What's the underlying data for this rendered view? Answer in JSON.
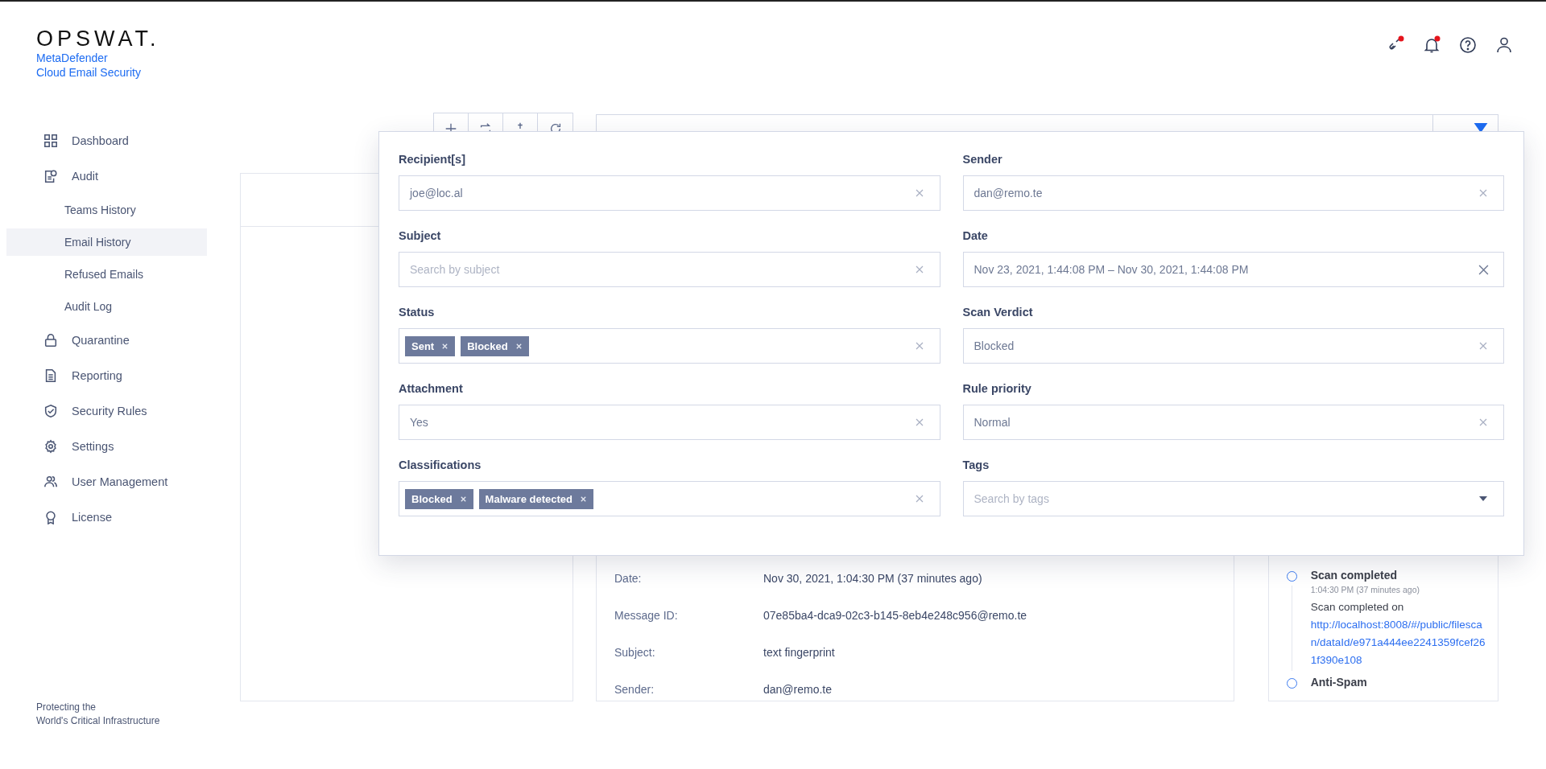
{
  "brand": {
    "logo": "OPSWAT.",
    "product_line1": "MetaDefender",
    "product_line2": "Cloud Email Security"
  },
  "header_icons": [
    {
      "alert": true
    },
    {
      "alert": true
    },
    {
      "alert": false
    },
    {
      "alert": false
    }
  ],
  "sidebar": {
    "items": [
      {
        "label": "Dashboard",
        "selected": false
      },
      {
        "label": "Audit",
        "selected": false,
        "children": [
          {
            "label": "Teams History",
            "selected": false
          },
          {
            "label": "Email History",
            "selected": true
          },
          {
            "label": "Refused Emails",
            "selected": false
          },
          {
            "label": "Audit Log",
            "selected": false
          }
        ]
      },
      {
        "label": "Quarantine",
        "selected": false
      },
      {
        "label": "Reporting",
        "selected": false
      },
      {
        "label": "Security Rules",
        "selected": false
      },
      {
        "label": "Settings",
        "selected": false
      },
      {
        "label": "User Management",
        "selected": false
      },
      {
        "label": "License",
        "selected": false
      }
    ],
    "footer_line1": "Protecting the",
    "footer_line2": "World's Critical Infrastructure"
  },
  "filter_panel": {
    "fields": [
      {
        "label": "Recipient[s]",
        "kind": "text",
        "value": "joe@loc.al"
      },
      {
        "label": "Sender",
        "kind": "text",
        "value": "dan@remo.te"
      },
      {
        "label": "Subject",
        "kind": "text",
        "placeholder": "Search by subject"
      },
      {
        "label": "Date",
        "kind": "date",
        "value": "Nov 23, 2021, 1:44:08 PM – Nov 30, 2021, 1:44:08 PM"
      },
      {
        "label": "Status",
        "kind": "tags",
        "tags": [
          "Sent",
          "Blocked"
        ]
      },
      {
        "label": "Scan Verdict",
        "kind": "text",
        "value": "Blocked"
      },
      {
        "label": "Attachment",
        "kind": "text",
        "value": "Yes"
      },
      {
        "label": "Rule priority",
        "kind": "text",
        "value": "Normal"
      },
      {
        "label": "Classifications",
        "kind": "tags",
        "tags": [
          "Blocked",
          "Malware detected"
        ]
      },
      {
        "label": "Tags",
        "kind": "dropdown",
        "placeholder": "Search by tags"
      }
    ]
  },
  "details": [
    {
      "label": "Date:",
      "value": "Nov 30, 2021, 1:04:30 PM (37 minutes ago)"
    },
    {
      "label": "Message ID:",
      "value": "07e85ba4-dca9-02c3-b145-8eb4e248c956@remo.te"
    },
    {
      "label": "Subject:",
      "value": "text fingerprint"
    },
    {
      "label": "Sender:",
      "value": "dan@remo.te"
    }
  ],
  "timeline": [
    {
      "title": "Scan completed",
      "time": "1:04:30 PM (37 minutes ago)",
      "text": "Scan completed on",
      "link": "http://localhost:8008/#/public/filescan/dataId/e971a444ee2241359fcef261f390e108"
    },
    {
      "title": "Anti-Spam"
    }
  ]
}
